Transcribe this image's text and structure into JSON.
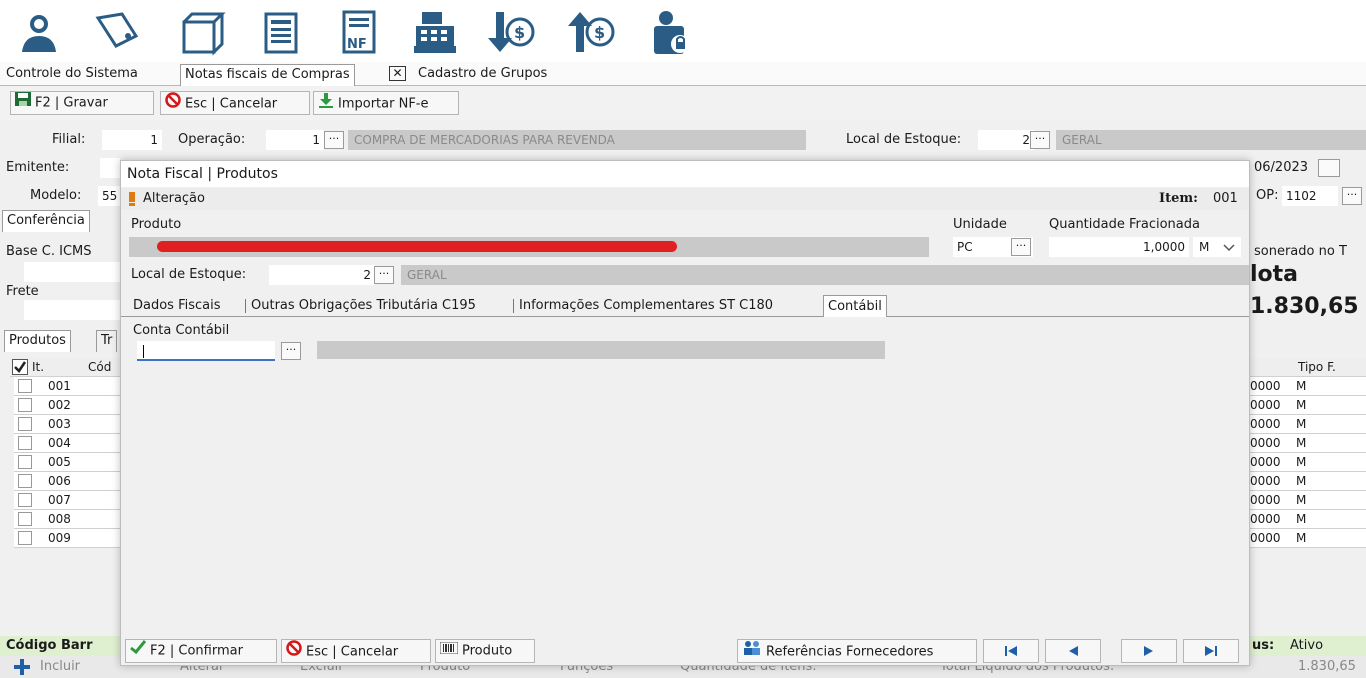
{
  "tabs": [
    {
      "label": "Controle do Sistema"
    },
    {
      "label": "Notas fiscais de Compras"
    },
    {
      "label": "Cadastro de Grupos"
    }
  ],
  "close_glyph": "✕",
  "toolbar": {
    "save_label": "F2 | Gravar",
    "cancel_label": "Esc | Cancelar",
    "import_label": "Importar NF-e"
  },
  "header": {
    "filial_label": "Filial:",
    "filial_value": "1",
    "operacao_label": "Operação:",
    "operacao_value": "1",
    "operacao_desc": "COMPRA DE MERCADORIAS PARA REVENDA",
    "local_label": "Local de Estoque:",
    "local_value": "2",
    "local_desc": "GERAL",
    "emitente_label": "Emitente:",
    "date_fragment": "06/2023",
    "modelo_label": "Modelo:",
    "modelo_value": "55",
    "cfop_fragment": "OP:",
    "cfop_value": "1102"
  },
  "behind": {
    "conferencia_tab": "Conferência",
    "base_icms_label": "Base C. ICMS",
    "frete_label": "Frete",
    "desonerado_label": "sonerado no T",
    "nota_label": "lota",
    "nota_total": "1.830,65",
    "produtos_tab": "Produtos",
    "tr_tab": "Tr",
    "col_it": "It.",
    "col_cod": "Cód",
    "col_tipo": "Tipo F.",
    "rows": [
      {
        "it": "001",
        "qty": "0000",
        "tipo": "M"
      },
      {
        "it": "002",
        "qty": "0000",
        "tipo": "M"
      },
      {
        "it": "003",
        "qty": "0000",
        "tipo": "M"
      },
      {
        "it": "004",
        "qty": "0000",
        "tipo": "M"
      },
      {
        "it": "005",
        "qty": "0000",
        "tipo": "M"
      },
      {
        "it": "006",
        "qty": "0000",
        "tipo": "M"
      },
      {
        "it": "007",
        "qty": "0000",
        "tipo": "M"
      },
      {
        "it": "008",
        "qty": "0000",
        "tipo": "M"
      },
      {
        "it": "009",
        "qty": "0000",
        "tipo": "M"
      }
    ],
    "codigo_barras_label": "Código Barr",
    "status_label": "us:",
    "status_value": "Ativo",
    "bottom": {
      "incluir": "Incluir",
      "alterar": "Alterar",
      "excluir": "Excluir",
      "produto": "Produto",
      "funcoes": "Funções",
      "qtd_itens": "Quantidade de Itens:",
      "total_liquido": "Total Líquido dos Produtos:",
      "total_value": "1.830,65"
    }
  },
  "modal": {
    "title": "Nota Fiscal | Produtos",
    "mode": "Alteração",
    "item_label": "Item:",
    "item_value": "001",
    "produto_label": "Produto",
    "unidade_label": "Unidade",
    "unidade_value": "PC",
    "qtd_label": "Quantidade Fracionada",
    "qtd_value": "1,0000",
    "qtd_unit": "M",
    "local_label": "Local de Estoque:",
    "local_value": "2",
    "local_desc": "GERAL",
    "subtabs": [
      {
        "label": "Dados Fiscais"
      },
      {
        "label": "Outras Obrigações Tributária C195"
      },
      {
        "label": "Informações Complementares ST C180"
      },
      {
        "label": "Contábil"
      }
    ],
    "conta_label": "Conta Contábil",
    "conta_value": "",
    "buttons": {
      "confirm": "F2 | Confirmar",
      "cancel": "Esc | Cancelar",
      "produto": "Produto",
      "referencias": "Referências Fornecedores"
    },
    "dots_glyph": "···"
  }
}
